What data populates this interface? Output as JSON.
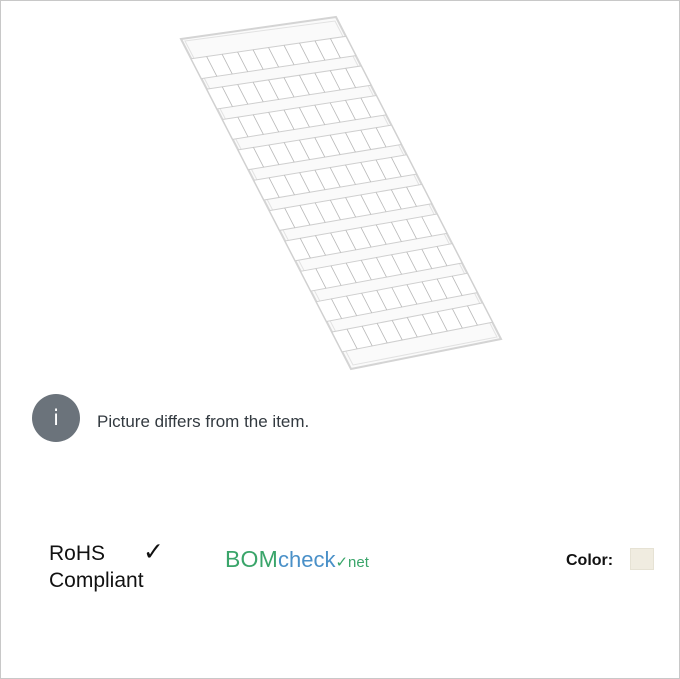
{
  "notice": {
    "icon": "info-icon",
    "icon_glyph": "i",
    "text": "Picture differs from the item."
  },
  "certifications": {
    "rohs": {
      "line1": "RoHS",
      "check_glyph": "✓",
      "line2": "Compliant",
      "check_icon": "checkmark-icon"
    },
    "bomcheck": {
      "part1": "BOM",
      "part2": "check",
      "part3": "✓net"
    }
  },
  "color": {
    "label": "Color:",
    "swatch": "#f0ece0"
  },
  "colors": {
    "badge_bg": "#6b737b",
    "border": "#c8c8c8",
    "bom_green": "#3aa56a",
    "bom_blue": "#4a90c8"
  }
}
